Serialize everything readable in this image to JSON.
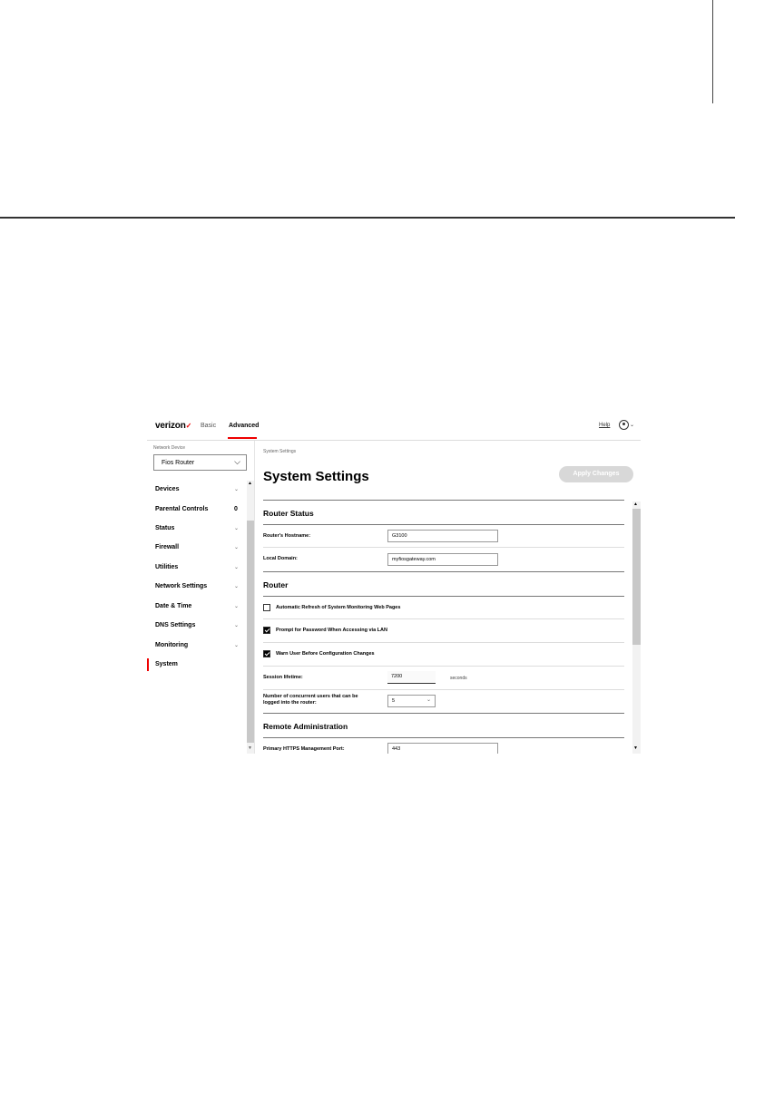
{
  "header": {
    "logo": "verizon",
    "logo_mark": "✓",
    "tabs": [
      {
        "label": "Basic",
        "active": false
      },
      {
        "label": "Advanced",
        "active": true
      }
    ],
    "help": "Help",
    "user_icon": "user-circle-icon",
    "accent_color": "#e00000"
  },
  "sidebar": {
    "network_device_label": "Network Device",
    "network_device_value": "Fios Router",
    "items": [
      {
        "label": "Devices",
        "chevron": true
      },
      {
        "label": "Parental Controls",
        "badge": "0"
      },
      {
        "label": "Status",
        "chevron": true
      },
      {
        "label": "Firewall",
        "chevron": true
      },
      {
        "label": "Utilities",
        "chevron": true
      },
      {
        "label": "Network Settings",
        "chevron": true
      },
      {
        "label": "Date & Time",
        "chevron": true
      },
      {
        "label": "DNS Settings",
        "chevron": true
      },
      {
        "label": "Monitoring",
        "chevron": true
      },
      {
        "label": "System",
        "active": true
      }
    ]
  },
  "main": {
    "breadcrumb": "System Settings",
    "title": "System Settings",
    "apply_button": "Apply Changes",
    "router_status": {
      "heading": "Router Status",
      "hostname_label": "Router's Hostname:",
      "hostname_value": "G3100",
      "domain_label": "Local Domain:",
      "domain_value": "myfiosgateway.com"
    },
    "router": {
      "heading": "Router",
      "options": [
        {
          "label": "Automatic Refresh of System Monitoring Web Pages",
          "checked": false
        },
        {
          "label": "Prompt for Password When Accessing via LAN",
          "checked": true
        },
        {
          "label": "Warn User Before Configuration Changes",
          "checked": true
        }
      ],
      "session_label": "Session lifetime:",
      "session_value": "7200",
      "session_unit": "seconds",
      "concurrent_label": "Number of concurrent users that can be logged into the router:",
      "concurrent_value": "5"
    },
    "remote_admin": {
      "heading": "Remote Administration",
      "https_port_label": "Primary HTTPS Management Port:",
      "https_port_value": "443"
    }
  }
}
